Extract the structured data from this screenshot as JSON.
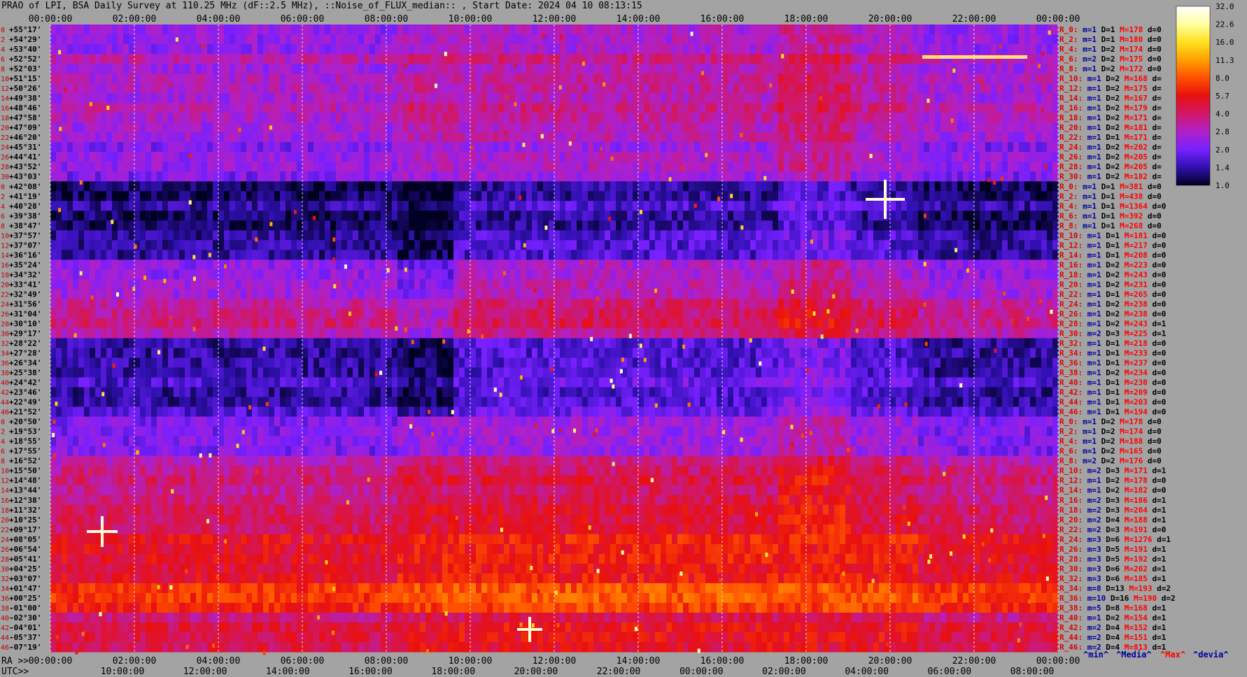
{
  "header": {
    "title": "PRAO of LPI, BSA Daily Survey at 110.25 MHz (dF::2.5 MHz), ::Noise_of_FLUX_median:: , Start Date: 2024 04 10 08:13:15"
  },
  "chart_data": {
    "type": "heatmap",
    "title": "PRAO of LPI, BSA Daily Survey at 110.25 MHz (dF::2.5 MHz), ::Noise_of_FLUX_median:: , Start Date: 2024 04 10 08:13:15",
    "top_time_ticks": [
      "00:00:00",
      "02:00:00",
      "04:00:00",
      "06:00:00",
      "08:00:00",
      "10:00:00",
      "12:00:00",
      "14:00:00",
      "16:00:00",
      "18:00:00",
      "20:00:00",
      "22:00:00",
      "00:00:00"
    ],
    "ra_ticks": [
      "00:00:00",
      "02:00:00",
      "04:00:00",
      "06:00:00",
      "08:00:00",
      "10:00:00",
      "12:00:00",
      "14:00:00",
      "16:00:00",
      "18:00:00",
      "20:00:00",
      "22:00:00",
      "00:00:00"
    ],
    "utc_ticks": [
      "10:00:00",
      "12:00:00",
      "14:00:00",
      "16:00:00",
      "18:00:00",
      "20:00:00",
      "22:00:00",
      "00:00:00",
      "02:00:00",
      "04:00:00",
      "06:00:00",
      "08:00:00"
    ],
    "ra_label": "RA >>",
    "utc_label": "UTC>>",
    "declinations": [
      "+55°17'",
      "+54°29'",
      "+53°40'",
      "+52°52'",
      "+52°03'",
      "+51°15'",
      "+50°26'",
      "+49°38'",
      "+48°46'",
      "+47°58'",
      "+47°09'",
      "+46°20'",
      "+45°31'",
      "+44°41'",
      "+43°52'",
      "+43°03'",
      "+42°08'",
      "+41°19'",
      "+40°28'",
      "+39°38'",
      "+38°47'",
      "+37°57'",
      "+37°07'",
      "+36°16'",
      "+35°24'",
      "+34°32'",
      "+33°41'",
      "+32°49'",
      "+31°56'",
      "+31°04'",
      "+30°10'",
      "+29°17'",
      "+28°22'",
      "+27°28'",
      "+26°34'",
      "+25°38'",
      "+24°42'",
      "+23°46'",
      "+22°49'",
      "+21°52'",
      "+20°50'",
      "+19°53'",
      "+18°55'",
      "+17°55'",
      "+16°52'",
      "+15°50'",
      "+14°48'",
      "+13°44'",
      "+12°38'",
      "+11°32'",
      "+10°25'",
      "+09°17'",
      "+08°05'",
      "+06°54'",
      "+05°41'",
      "+04°25'",
      "+03°07'",
      "+01°47'",
      "+00°25'",
      "-01°00'",
      "-02°30'",
      "-04°01'",
      "-05°37'",
      "-07°19'"
    ],
    "row_indices": [
      "0",
      "2",
      "4",
      "6",
      "8",
      "10",
      "12",
      "14",
      "16",
      "18",
      "20",
      "22",
      "24",
      "26",
      "28",
      "30",
      "0",
      "2",
      "4",
      "6",
      "8",
      "10",
      "12",
      "14",
      "16",
      "18",
      "20",
      "22",
      "24",
      "26",
      "28",
      "30",
      "32",
      "34",
      "36",
      "38",
      "40",
      "42",
      "44",
      "46",
      "0",
      "2",
      "4",
      "6",
      "8",
      "10",
      "12",
      "14",
      "16",
      "18",
      "20",
      "22",
      "24",
      "26",
      "28",
      "30",
      "32",
      "34",
      "36",
      "38",
      "40",
      "42",
      "44",
      "46"
    ],
    "row_stats": [
      [
        "R_0:",
        "1",
        "1",
        "178",
        "0"
      ],
      [
        "R_2:",
        "1",
        "1",
        "180",
        "0"
      ],
      [
        "R_4:",
        "1",
        "2",
        "174",
        "0"
      ],
      [
        "R_6:",
        "2",
        "2",
        "175",
        "0"
      ],
      [
        "R_8:",
        "1",
        "2",
        "172",
        "0"
      ],
      [
        "R_10:",
        "1",
        "2",
        "168",
        ""
      ],
      [
        "R_12:",
        "1",
        "2",
        "175",
        ""
      ],
      [
        "R_14:",
        "1",
        "2",
        "167",
        ""
      ],
      [
        "R_16:",
        "1",
        "2",
        "179",
        ""
      ],
      [
        "R_18:",
        "1",
        "2",
        "171",
        ""
      ],
      [
        "R_20:",
        "1",
        "2",
        "181",
        ""
      ],
      [
        "R_22:",
        "1",
        "1",
        "171",
        ""
      ],
      [
        "R_24:",
        "1",
        "2",
        "202",
        ""
      ],
      [
        "R_26:",
        "1",
        "2",
        "205",
        ""
      ],
      [
        "R_28:",
        "1",
        "2",
        "205",
        ""
      ],
      [
        "R_30:",
        "1",
        "2",
        "182",
        ""
      ],
      [
        "R_0:",
        "1",
        "1",
        "381",
        "0"
      ],
      [
        "R_2:",
        "1",
        "1",
        "438",
        "0"
      ],
      [
        "R_4:",
        "1",
        "1",
        "1364",
        "0"
      ],
      [
        "R_6:",
        "1",
        "1",
        "392",
        "0"
      ],
      [
        "R_8:",
        "1",
        "1",
        "268",
        "0"
      ],
      [
        "R_10:",
        "1",
        "1",
        "181",
        "0"
      ],
      [
        "R_12:",
        "1",
        "1",
        "217",
        "0"
      ],
      [
        "R_14:",
        "1",
        "1",
        "208",
        "0"
      ],
      [
        "R_16:",
        "1",
        "2",
        "223",
        "0"
      ],
      [
        "R_18:",
        "1",
        "2",
        "243",
        "0"
      ],
      [
        "R_20:",
        "1",
        "2",
        "231",
        "0"
      ],
      [
        "R_22:",
        "1",
        "1",
        "265",
        "0"
      ],
      [
        "R_24:",
        "1",
        "2",
        "238",
        "0"
      ],
      [
        "R_26:",
        "1",
        "2",
        "238",
        "0"
      ],
      [
        "R_28:",
        "1",
        "2",
        "243",
        "1"
      ],
      [
        "R_30:",
        "2",
        "3",
        "225",
        "1"
      ],
      [
        "R_32:",
        "1",
        "1",
        "218",
        "0"
      ],
      [
        "R_34:",
        "1",
        "1",
        "233",
        "0"
      ],
      [
        "R_36:",
        "1",
        "1",
        "237",
        "0"
      ],
      [
        "R_38:",
        "1",
        "2",
        "234",
        "0"
      ],
      [
        "R_40:",
        "1",
        "1",
        "230",
        "0"
      ],
      [
        "R_42:",
        "1",
        "1",
        "209",
        "0"
      ],
      [
        "R_44:",
        "1",
        "1",
        "203",
        "0"
      ],
      [
        "R_46:",
        "1",
        "1",
        "194",
        "0"
      ],
      [
        "R_0:",
        "1",
        "2",
        "178",
        "0"
      ],
      [
        "R_2:",
        "1",
        "2",
        "174",
        "0"
      ],
      [
        "R_4:",
        "1",
        "2",
        "188",
        "0"
      ],
      [
        "R_6:",
        "1",
        "2",
        "165",
        "0"
      ],
      [
        "R_8:",
        "2",
        "2",
        "176",
        "0"
      ],
      [
        "R_10:",
        "2",
        "3",
        "171",
        "1"
      ],
      [
        "R_12:",
        "1",
        "2",
        "178",
        "0"
      ],
      [
        "R_14:",
        "1",
        "2",
        "182",
        "0"
      ],
      [
        "R_16:",
        "2",
        "3",
        "186",
        "1"
      ],
      [
        "R_18:",
        "2",
        "3",
        "204",
        "1"
      ],
      [
        "R_20:",
        "2",
        "4",
        "188",
        "1"
      ],
      [
        "R_22:",
        "2",
        "3",
        "191",
        "0"
      ],
      [
        "R_24:",
        "3",
        "6",
        "1276",
        "1"
      ],
      [
        "R_26:",
        "3",
        "5",
        "191",
        "1"
      ],
      [
        "R_28:",
        "3",
        "5",
        "192",
        "1"
      ],
      [
        "R_30:",
        "3",
        "6",
        "202",
        "1"
      ],
      [
        "R_32:",
        "3",
        "6",
        "185",
        "1"
      ],
      [
        "R_34:",
        "8",
        "13",
        "193",
        "2"
      ],
      [
        "R_36:",
        "10",
        "16",
        "190",
        "2"
      ],
      [
        "R_38:",
        "5",
        "8",
        "168",
        "1"
      ],
      [
        "R_40:",
        "1",
        "2",
        "154",
        "1"
      ],
      [
        "R_42:",
        "2",
        "4",
        "152",
        "1"
      ],
      [
        "R_44:",
        "2",
        "4",
        "151",
        "1"
      ],
      [
        "R_46:",
        "2",
        "4",
        "813",
        "1"
      ]
    ],
    "stats_prefixes": {
      "m": "m=",
      "D": "D=",
      "M": "M=",
      "d": "d="
    },
    "stats_legend": {
      "min": "^min^",
      "median": "^Media^",
      "max": "^Max^",
      "devia": "^devia^"
    },
    "colorbar": {
      "ticks": [
        "32.0",
        "22.6",
        "16.0",
        "11.3",
        "8.0",
        "5.7",
        "4.0",
        "2.8",
        "2.0",
        "1.4",
        "1.0"
      ],
      "stops": [
        "#ffffff",
        "#ffffa0",
        "#ffe020",
        "#ffa000",
        "#ff5000",
        "#e81010",
        "#d01868",
        "#b020c8",
        "#7820ff",
        "#3010b0",
        "#000020"
      ]
    },
    "colors": {
      "background": "#a3a3a3",
      "stats_label": "#e00000",
      "stats_value": "#000000",
      "stats_M": "#ff0000",
      "stats_legend_blue": "#0000a0",
      "stats_legend_red": "#ff0000"
    },
    "row_bands": [
      1,
      1,
      1,
      1.3,
      1.1,
      1.2,
      1.2,
      1.1,
      1.3,
      1.2,
      1.1,
      1.1,
      0.9,
      1.0,
      1.0,
      0.9,
      0.5,
      0.5,
      0.6,
      0.5,
      0.5,
      0.6,
      0.6,
      0.6,
      1.0,
      1.0,
      1.1,
      1.1,
      1.4,
      1.5,
      1.6,
      1.3,
      0.6,
      0.6,
      0.6,
      0.6,
      0.7,
      0.6,
      0.6,
      0.7,
      0.9,
      0.9,
      0.9,
      0.9,
      1.3,
      1.5,
      1.7,
      1.5,
      1.6,
      1.8,
      1.8,
      1.8,
      2.3,
      2.2,
      2.2,
      2.1,
      2.2,
      2.9,
      3.0,
      2.7,
      1.6,
      2.0,
      2.0,
      1.9
    ]
  }
}
